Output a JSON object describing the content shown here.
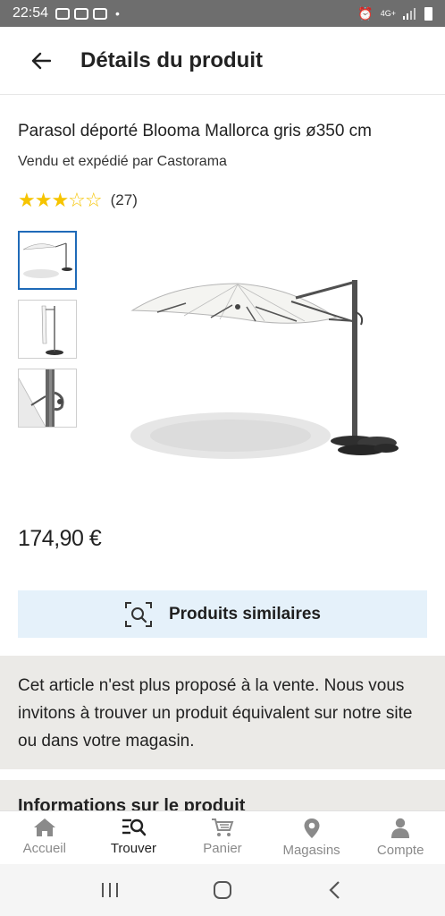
{
  "status_bar": {
    "time": "22:54",
    "network": "4G+"
  },
  "header": {
    "title": "Détails du produit"
  },
  "product": {
    "title": "Parasol déporté Blooma Mallorca gris ø350 cm",
    "seller": "Vendu et expédié par Castorama",
    "rating": 3,
    "rating_max": 5,
    "stars_full": "★★★",
    "stars_empty": "☆☆",
    "review_count": "(27)",
    "price": "174,90 €"
  },
  "similar_button": {
    "label": "Produits similaires"
  },
  "notice": {
    "text": "Cet article n'est plus proposé à la vente. Nous vous invitons à trouver un produit équivalent sur notre site ou dans votre magasin."
  },
  "section_peek": {
    "label": "Informations sur le produit"
  },
  "bottom_nav": {
    "items": [
      {
        "label": "Accueil",
        "icon": "home-icon"
      },
      {
        "label": "Trouver",
        "icon": "search-list-icon",
        "active": true
      },
      {
        "label": "Panier",
        "icon": "cart-icon"
      },
      {
        "label": "Magasins",
        "icon": "location-pin-icon"
      },
      {
        "label": "Compte",
        "icon": "person-icon"
      }
    ]
  },
  "colors": {
    "accent": "#1f6ab8",
    "star": "#f6c400",
    "similar_bg": "#e5f1fa",
    "notice_bg": "#ebeae7"
  }
}
